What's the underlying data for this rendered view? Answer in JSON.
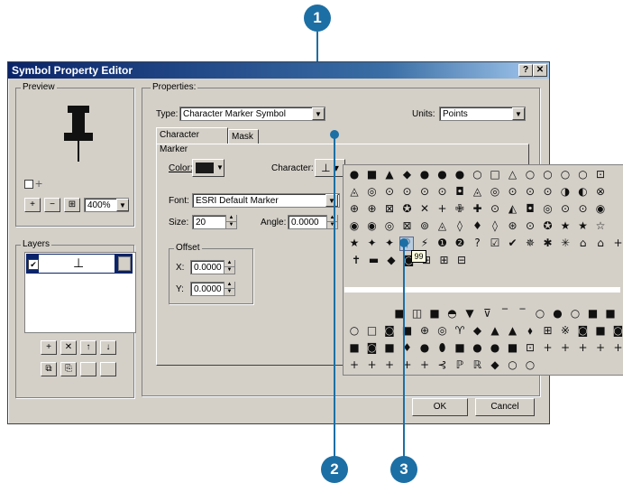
{
  "callouts": [
    "1",
    "2",
    "3"
  ],
  "window": {
    "title": "Symbol Property Editor",
    "help_btn": "?",
    "close_btn": "✕"
  },
  "preview": {
    "group_label": "Preview",
    "zoom_value": "400%",
    "symbol": "📌"
  },
  "layers": {
    "group_label": "Layers",
    "buttons": [
      "+",
      "✕",
      "↑",
      "↓"
    ]
  },
  "properties": {
    "group_label": "Properties:",
    "type_label": "Type:",
    "type_value": "Character Marker Symbol",
    "units_label": "Units:",
    "units_value": "Points",
    "tabs": [
      "Character Marker",
      "Mask"
    ],
    "color_label": "Color:",
    "character_label": "Character:",
    "font_label": "Font:",
    "font_value": "ESRI Default Marker",
    "size_label": "Size:",
    "size_value": "20",
    "angle_label": "Angle:",
    "angle_value": "0.0000",
    "offset_label": "Offset",
    "x_label": "X:",
    "x_value": "0.0000",
    "y_label": "Y:",
    "y_value": "0.0000"
  },
  "footer": {
    "ok_label": "OK",
    "cancel_label": "Cancel"
  },
  "char_grid": {
    "tooltip": "99",
    "rows": [
      "●■▲◆●●●○□△○○○○⊡",
      "◬◎⊙⊙⊙⊙◘◬◎⊙⊙⊙◑◐⊗",
      "⊕⊕⊠✪✕+✙✚⊙◭◘◎⊙⊙◉",
      "◉◉◎⊠⊚◬◊♦◊⊛⊙✪★★☆",
      "★✦✦⚲⚡❶❷?☑✔✵✱✳⌂⌂+",
      "✝▬◆◙⊞⊞⊟",
      "■◫■◓▼⊽‾‾○●○■■",
      "○□◙■⊕◎♈◆▲▲⬧⊞※◙■◙",
      "■◙■♦●⬮■●●■⊡++++++",
      "+++++⊰ℙℝ◆○○"
    ]
  }
}
